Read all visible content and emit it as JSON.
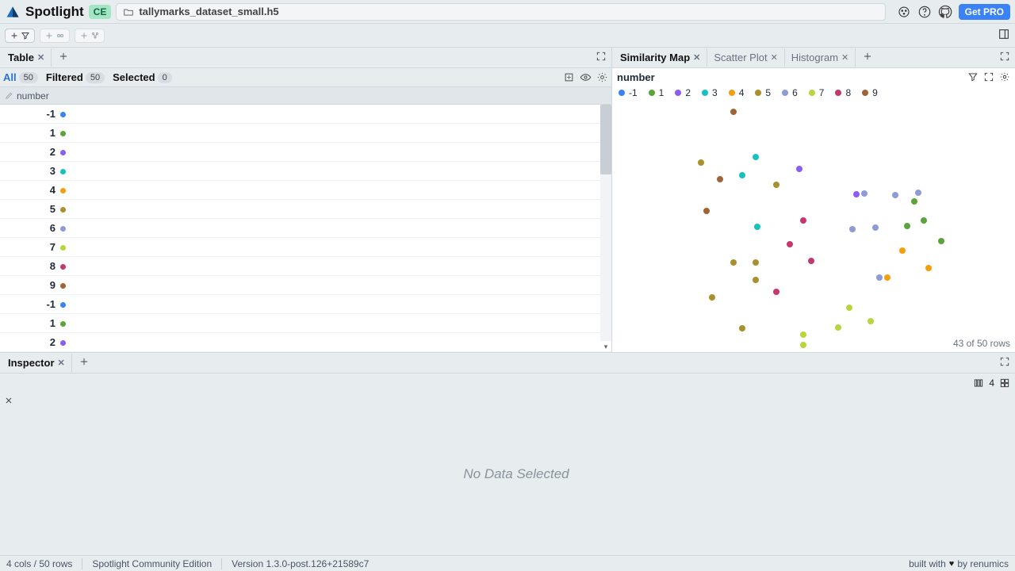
{
  "app": {
    "name": "Spotlight",
    "edition_badge": "CE",
    "get_pro": "Get PRO"
  },
  "file": {
    "name": "tallymarks_dataset_small.h5"
  },
  "panel_left": {
    "title": "Table"
  },
  "filters": {
    "all_label": "All",
    "all_count": "50",
    "filtered_label": "Filtered",
    "filtered_count": "50",
    "selected_label": "Selected",
    "selected_count": "0"
  },
  "column_header": "number",
  "rows": [
    {
      "n": "-1",
      "c": "#3b82f6"
    },
    {
      "n": "1",
      "c": "#5aa43a"
    },
    {
      "n": "2",
      "c": "#8b5cf6"
    },
    {
      "n": "3",
      "c": "#17c1c1"
    },
    {
      "n": "4",
      "c": "#f59e0b"
    },
    {
      "n": "5",
      "c": "#a98f2d"
    },
    {
      "n": "6",
      "c": "#8d9bd8"
    },
    {
      "n": "7",
      "c": "#b7d63a"
    },
    {
      "n": "8",
      "c": "#c5376e"
    },
    {
      "n": "9",
      "c": "#a06436"
    },
    {
      "n": "-1",
      "c": "#3b82f6"
    },
    {
      "n": "1",
      "c": "#5aa43a"
    },
    {
      "n": "2",
      "c": "#8b5cf6"
    }
  ],
  "panel_right_tabs": [
    {
      "label": "Similarity Map",
      "active": true
    },
    {
      "label": "Scatter Plot",
      "active": false
    },
    {
      "label": "Histogram",
      "active": false
    }
  ],
  "map": {
    "title": "number",
    "legend": [
      {
        "label": "-1",
        "c": "#3b82f6"
      },
      {
        "label": "1",
        "c": "#5aa43a"
      },
      {
        "label": "2",
        "c": "#8b5cf6"
      },
      {
        "label": "3",
        "c": "#17c1c1"
      },
      {
        "label": "4",
        "c": "#f59e0b"
      },
      {
        "label": "5",
        "c": "#a98f2d"
      },
      {
        "label": "6",
        "c": "#8d9bd8"
      },
      {
        "label": "7",
        "c": "#b7d63a"
      },
      {
        "label": "8",
        "c": "#c5376e"
      },
      {
        "label": "9",
        "c": "#a06436"
      }
    ],
    "points": [
      {
        "x": 30.1,
        "y": 4.0,
        "c": "#a06436"
      },
      {
        "x": 35.6,
        "y": 22.3,
        "c": "#17c1c1"
      },
      {
        "x": 32.2,
        "y": 29.3,
        "c": "#17c1c1"
      },
      {
        "x": 36.1,
        "y": 50.1,
        "c": "#17c1c1"
      },
      {
        "x": 22.0,
        "y": 24.3,
        "c": "#a98f2d"
      },
      {
        "x": 26.7,
        "y": 31.0,
        "c": "#a06436"
      },
      {
        "x": 23.4,
        "y": 43.6,
        "c": "#a06436"
      },
      {
        "x": 30.1,
        "y": 64.3,
        "c": "#a98f2d"
      },
      {
        "x": 35.6,
        "y": 71.3,
        "c": "#a98f2d"
      },
      {
        "x": 24.8,
        "y": 78.3,
        "c": "#a98f2d"
      },
      {
        "x": 32.2,
        "y": 90.6,
        "c": "#a98f2d"
      },
      {
        "x": 40.7,
        "y": 33.3,
        "c": "#a98f2d"
      },
      {
        "x": 40.7,
        "y": 76.0,
        "c": "#c5376e"
      },
      {
        "x": 44.1,
        "y": 57.0,
        "c": "#c5376e"
      },
      {
        "x": 47.5,
        "y": 47.6,
        "c": "#c5376e"
      },
      {
        "x": 49.5,
        "y": 63.6,
        "c": "#c5376e"
      },
      {
        "x": 46.4,
        "y": 27.0,
        "c": "#8b5cf6"
      },
      {
        "x": 60.7,
        "y": 37.0,
        "c": "#8b5cf6"
      },
      {
        "x": 59.6,
        "y": 50.9,
        "c": "#8d9bd8"
      },
      {
        "x": 65.3,
        "y": 50.3,
        "c": "#8d9bd8"
      },
      {
        "x": 62.5,
        "y": 36.6,
        "c": "#8d9bd8"
      },
      {
        "x": 66.4,
        "y": 70.3,
        "c": "#8d9bd8"
      },
      {
        "x": 70.2,
        "y": 37.3,
        "c": "#8d9bd8"
      },
      {
        "x": 75.0,
        "y": 40.0,
        "c": "#5aa43a"
      },
      {
        "x": 73.3,
        "y": 49.6,
        "c": "#5aa43a"
      },
      {
        "x": 75.9,
        "y": 36.3,
        "c": "#8d9bd8"
      },
      {
        "x": 77.3,
        "y": 47.6,
        "c": "#5aa43a"
      },
      {
        "x": 81.6,
        "y": 55.6,
        "c": "#5aa43a"
      },
      {
        "x": 72.0,
        "y": 59.6,
        "c": "#f59e0b"
      },
      {
        "x": 68.3,
        "y": 70.3,
        "c": "#f59e0b"
      },
      {
        "x": 78.5,
        "y": 66.6,
        "c": "#f59e0b"
      },
      {
        "x": 58.8,
        "y": 82.3,
        "c": "#b7d63a"
      },
      {
        "x": 56.2,
        "y": 90.3,
        "c": "#b7d63a"
      },
      {
        "x": 47.5,
        "y": 92.9,
        "c": "#b7d63a"
      },
      {
        "x": 47.5,
        "y": 97.0,
        "c": "#b7d63a"
      },
      {
        "x": 64.2,
        "y": 87.6,
        "c": "#b7d63a"
      },
      {
        "x": 35.6,
        "y": 64.3,
        "c": "#a98f2d"
      }
    ],
    "rowcount": "43 of 50 rows"
  },
  "inspector": {
    "title": "Inspector",
    "layout_count": "4",
    "empty_text": "No Data Selected"
  },
  "status": {
    "cols_rows": "4 cols / 50 rows",
    "edition": "Spotlight Community Edition",
    "version": "Version 1.3.0-post.126+21589c7",
    "credit_prefix": "built with ",
    "credit_suffix": " by renumics"
  },
  "chart_data": {
    "type": "scatter",
    "title": "Similarity Map",
    "color_by": "number",
    "categories_colors": {
      "-1": "#3b82f6",
      "1": "#5aa43a",
      "2": "#8b5cf6",
      "3": "#17c1c1",
      "4": "#f59e0b",
      "5": "#a98f2d",
      "6": "#8d9bd8",
      "7": "#b7d63a",
      "8": "#c5376e",
      "9": "#a06436"
    },
    "note": "Axes unlabeled (embedding space). 43 of 50 rows plotted.",
    "n_points_visible": 43,
    "n_points_total": 50
  }
}
